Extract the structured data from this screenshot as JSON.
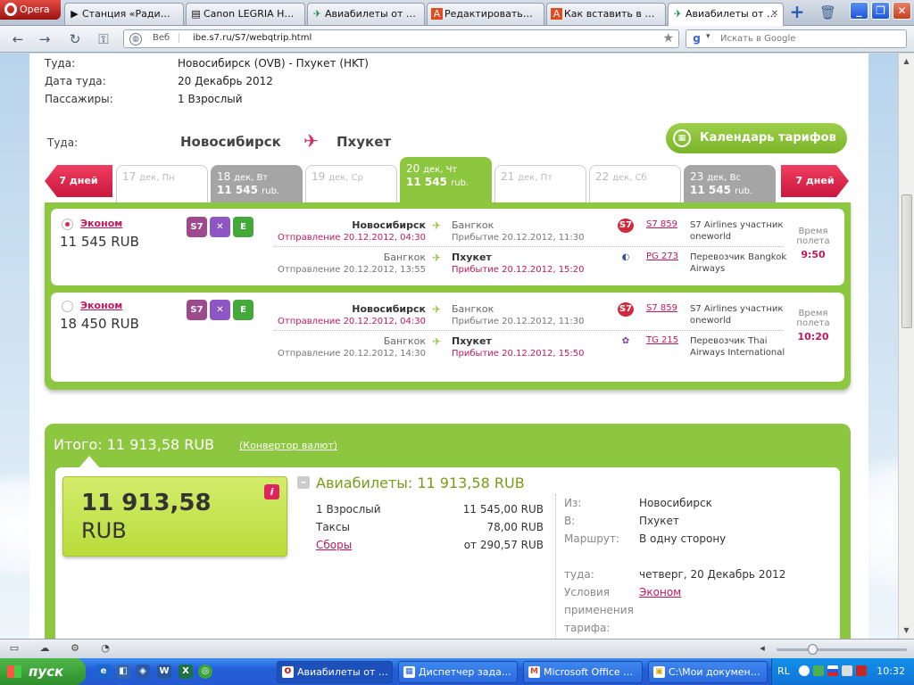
{
  "browser": {
    "menu_label": "Opera",
    "tabs": [
      {
        "title": "Станция «Ради…",
        "icon": "▶"
      },
      {
        "title": "Canon LEGRIA H…",
        "icon": "▤"
      },
      {
        "title": "Авиабилеты от …",
        "icon": "✈"
      },
      {
        "title": "Редактировать…",
        "icon": "A"
      },
      {
        "title": "Как вставить в …",
        "icon": "A"
      },
      {
        "title": "Авиабилеты от …",
        "icon": "✈"
      }
    ],
    "address": {
      "mode": "Веб",
      "url": "ibe.s7.ru/S7/webqtrip.html"
    },
    "search_placeholder": "Искать в Google"
  },
  "trip_summary": {
    "from_label": "Туда:",
    "from_value": "Новосибирск (OVB)  -  Пхукет (HKT)",
    "date_label": "Дата туда:",
    "date_value": "20 Декабрь 2012",
    "pax_label": "Пассажиры:",
    "pax_value": "1 Взрослый"
  },
  "route": {
    "label": "Туда:",
    "origin": "Новосибирск",
    "destination": "Пхукет",
    "calendar_button": "Календарь тарифов"
  },
  "days": {
    "prev_label": "7 дней",
    "next_label": "7 дней",
    "items": [
      {
        "date": "17",
        "dow": "дек, Пн",
        "price": "",
        "cur": ""
      },
      {
        "date": "18",
        "dow": "дек, Вт",
        "price": "11 545",
        "cur": "rub."
      },
      {
        "date": "19",
        "dow": "дек, Ср",
        "price": "",
        "cur": ""
      },
      {
        "date": "20",
        "dow": "дек, Чт",
        "price": "11 545",
        "cur": "rub."
      },
      {
        "date": "21",
        "dow": "дек, Пт",
        "price": "",
        "cur": ""
      },
      {
        "date": "22",
        "dow": "дек, Сб",
        "price": "",
        "cur": ""
      },
      {
        "date": "23",
        "dow": "дек, Вс",
        "price": "11 545",
        "cur": "rub."
      }
    ]
  },
  "flights": [
    {
      "class": "Эконом",
      "price": "11 545 RUB",
      "duration_label": "Время полета",
      "duration": "9:50",
      "segments": [
        {
          "from": "Новосибирск",
          "dep": "Отправление 20.12.2012, 04:30",
          "to": "Бангкок",
          "arr": "Прибытие 20.12.2012, 11:30",
          "flight": "S7 859",
          "carrier": "S7 Airlines участник oneworld"
        },
        {
          "from": "Бангкок",
          "dep": "Отправление 20.12.2012, 13:55",
          "to": "Пхукет",
          "arr": "Прибытие 20.12.2012, 15:20",
          "flight": "PG 273",
          "carrier": "Перевозчик Bangkok Airways"
        }
      ]
    },
    {
      "class": "Эконом",
      "price": "18 450 RUB",
      "duration_label": "Время полета",
      "duration": "10:20",
      "segments": [
        {
          "from": "Новосибирск",
          "dep": "Отправление 20.12.2012, 04:30",
          "to": "Бангкок",
          "arr": "Прибытие 20.12.2012, 11:30",
          "flight": "S7 859",
          "carrier": "S7 Airlines участник oneworld"
        },
        {
          "from": "Бангкок",
          "dep": "Отправление 20.12.2012, 14:30",
          "to": "Пхукет",
          "arr": "Прибытие 20.12.2012, 15:50",
          "flight": "TG 215",
          "carrier": "Перевозчик Thai Airways International"
        }
      ]
    }
  ],
  "badges": [
    "S7",
    "✕",
    "E"
  ],
  "total": {
    "title": "Итого: 11 913,58 RUB",
    "converter": "(Конвертор валют)",
    "big_amount": "11 913,58",
    "big_currency": "RUB",
    "tickets_title": "Авиабилеты: 11 913,58 RUB",
    "rows": [
      {
        "label": "1 Взрослый",
        "value": "11 545,00 RUB"
      },
      {
        "label": "Таксы",
        "value": "78,00 RUB"
      },
      {
        "label": "Сборы",
        "value": "от 290,57 RUB"
      }
    ],
    "details": {
      "from_label": "Из:",
      "from": "Новосибирск",
      "to_label": "В:",
      "to": "Пхукет",
      "route_label": "Маршрут:",
      "route": "В одну сторону",
      "date_label": "туда:",
      "date": "четверг, 20 Декабрь 2012",
      "cond_label": "Условия применения тарифа:",
      "cond": "Эконом"
    }
  },
  "taskbar": {
    "start": "пуск",
    "tasks": [
      {
        "label": "Авиабилеты от …",
        "icon": "O"
      },
      {
        "label": "Диспетчер зада…",
        "icon": "▦"
      },
      {
        "label": "Microsoft Office …",
        "icon": "M"
      },
      {
        "label": "С:\\Мои докумен…",
        "icon": "▣"
      }
    ],
    "lang": "RL",
    "clock": "10:32"
  },
  "colors": {
    "green": "#8dc63f",
    "magenta": "#c2185b",
    "red": "#e0245e"
  }
}
